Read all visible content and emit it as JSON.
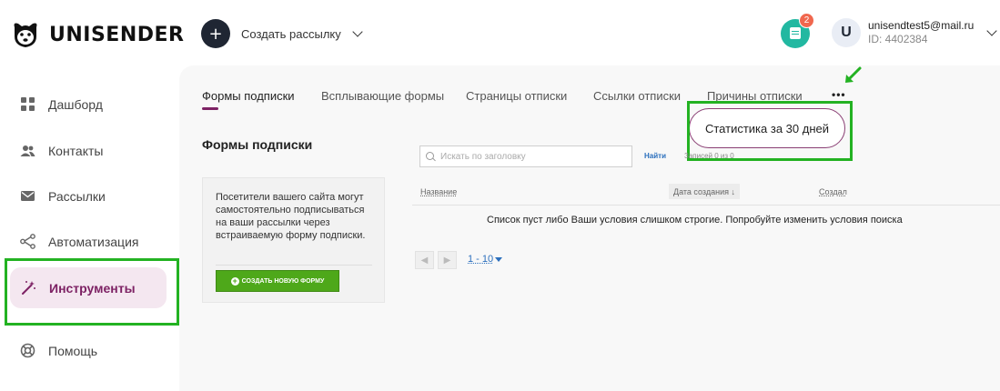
{
  "header": {
    "brand": "UNISENDER",
    "create_button": "Создать рассылку",
    "notifications_count": "2",
    "user": {
      "initial": "U",
      "email": "unisendtest5@mail.ru",
      "id_label": "ID: 4402384"
    }
  },
  "sidebar": {
    "items": [
      {
        "label": "Дашборд",
        "icon": "dashboard-icon",
        "active": false
      },
      {
        "label": "Контакты",
        "icon": "contacts-icon",
        "active": false
      },
      {
        "label": "Рассылки",
        "icon": "mail-icon",
        "active": false
      },
      {
        "label": "Автоматизация",
        "icon": "automation-icon",
        "active": false
      },
      {
        "label": "Инструменты",
        "icon": "magic-wand-icon",
        "active": true
      },
      {
        "label": "Помощь",
        "icon": "help-icon",
        "active": false
      }
    ]
  },
  "tabs": [
    {
      "label": "Формы подписки",
      "active": true
    },
    {
      "label": "Всплывающие формы",
      "active": false
    },
    {
      "label": "Страницы отписки",
      "active": false
    },
    {
      "label": "Ссылки отписки",
      "active": false
    },
    {
      "label": "Причины отписки",
      "active": false
    }
  ],
  "more_menu": {
    "dots": "•••",
    "stats_item": "Статистика за 30 дней"
  },
  "section": {
    "title": "Формы подписки",
    "info_text": "Посетители вашего сайта могут самостоятельно подписываться на ваши рассылки через встраиваемую форму подписки.",
    "new_form_button": "СОЗДАТЬ НОВУЮ ФОРМУ"
  },
  "search": {
    "placeholder": "Искать по заголовку",
    "find_label": "Найти",
    "records": "Записей 0 из 0"
  },
  "table": {
    "columns": {
      "name": "Название",
      "date": "Дата создания ↓",
      "author": "Создал"
    },
    "empty_message": "Список пуст либо Ваши условия слишком строгие. Попробуйте изменить условия поиска"
  },
  "pagination": {
    "prev": "◀",
    "next": "▶",
    "range": "1 - 10"
  },
  "colors": {
    "accent": "#7d2264",
    "highlight": "#23b222",
    "notif": "#22b8a1",
    "badge": "#f0674e",
    "green_button": "#4ea81a"
  }
}
